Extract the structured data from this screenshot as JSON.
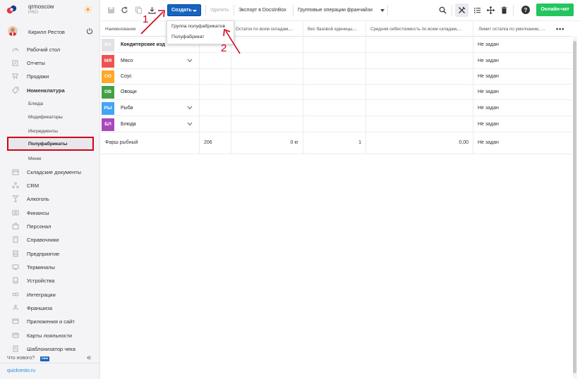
{
  "sidebar": {
    "brand": "qrmoscow",
    "plan": "PRO",
    "user": "Кирилл Рестов",
    "items": [
      {
        "label": "Рабочий стол",
        "icon": "dashboard-icon"
      },
      {
        "label": "Отчеты",
        "icon": "reports-icon"
      },
      {
        "label": "Продажи",
        "icon": "sales-icon"
      },
      {
        "label": "Номенклатура",
        "icon": "tag-icon"
      }
    ],
    "subitems": [
      "Блюда",
      "Модификаторы",
      "Ингредиенты",
      "Полуфабрикаты",
      "Меню"
    ],
    "items2": [
      {
        "label": "Складские документы",
        "icon": "warehouse-icon"
      },
      {
        "label": "CRM",
        "icon": "crm-icon"
      },
      {
        "label": "Алкоголь",
        "icon": "glass-icon"
      },
      {
        "label": "Финансы",
        "icon": "finance-icon"
      },
      {
        "label": "Персонал",
        "icon": "staff-icon"
      },
      {
        "label": "Справочники",
        "icon": "book-icon"
      },
      {
        "label": "Предприятие",
        "icon": "building-icon"
      },
      {
        "label": "Терминалы",
        "icon": "terminal-icon"
      },
      {
        "label": "Устройства",
        "icon": "device-icon"
      },
      {
        "label": "Интеграции",
        "icon": "integration-icon"
      },
      {
        "label": "Франшиза",
        "icon": "franchise-icon"
      },
      {
        "label": "Приложения и сайт",
        "icon": "app-icon"
      },
      {
        "label": "Карты лояльности",
        "icon": "card-icon"
      },
      {
        "label": "Шаблонизатор чека",
        "icon": "receipt-icon"
      }
    ],
    "whats_new": "Что нового?",
    "new_badge": "new",
    "site": "quickresto.ru"
  },
  "toolbar": {
    "create": "Создать",
    "delete": "Удалить",
    "export": "Экспорт в DocsInBox",
    "franchise": "Групповые операции франчайзи",
    "chat": "Онлайн-чат"
  },
  "dropdown": {
    "items": [
      "Группа полуфабрикатов",
      "Полуфабрикат"
    ]
  },
  "annotations": {
    "one": "1",
    "two": "2"
  },
  "table": {
    "headers": [
      "Наименование",
      "Остаток по всем складам,...",
      "Вес базовой единицы,...",
      "Средняя себестоимость по всем складам,...",
      "Лимит остатка по умолчанию, ..."
    ],
    "groups": [
      {
        "code": "КО",
        "name": "Кондитерские изд",
        "color": "#e2e2e6",
        "limit": "Не задан"
      },
      {
        "code": "МЯ",
        "name": "Мясо",
        "color": "#ef5350",
        "limit": "Не задан"
      },
      {
        "code": "СО",
        "name": "Соус",
        "color": "#ffa726",
        "limit": "Не задан"
      },
      {
        "code": "ОВ",
        "name": "Овощи",
        "color": "#43a047",
        "limit": "Не задан"
      },
      {
        "code": "РЫ",
        "name": "Рыба",
        "color": "#42a5f5",
        "limit": "Не задан"
      },
      {
        "code": "БЛ",
        "name": "Блюда",
        "color": "#ab47bc",
        "limit": "Не задан"
      }
    ],
    "item": {
      "name": "Фарш рыбный",
      "code": "206",
      "stock": "0 кг",
      "weight": "1",
      "cost": "0,00",
      "limit": "Не задан"
    }
  }
}
